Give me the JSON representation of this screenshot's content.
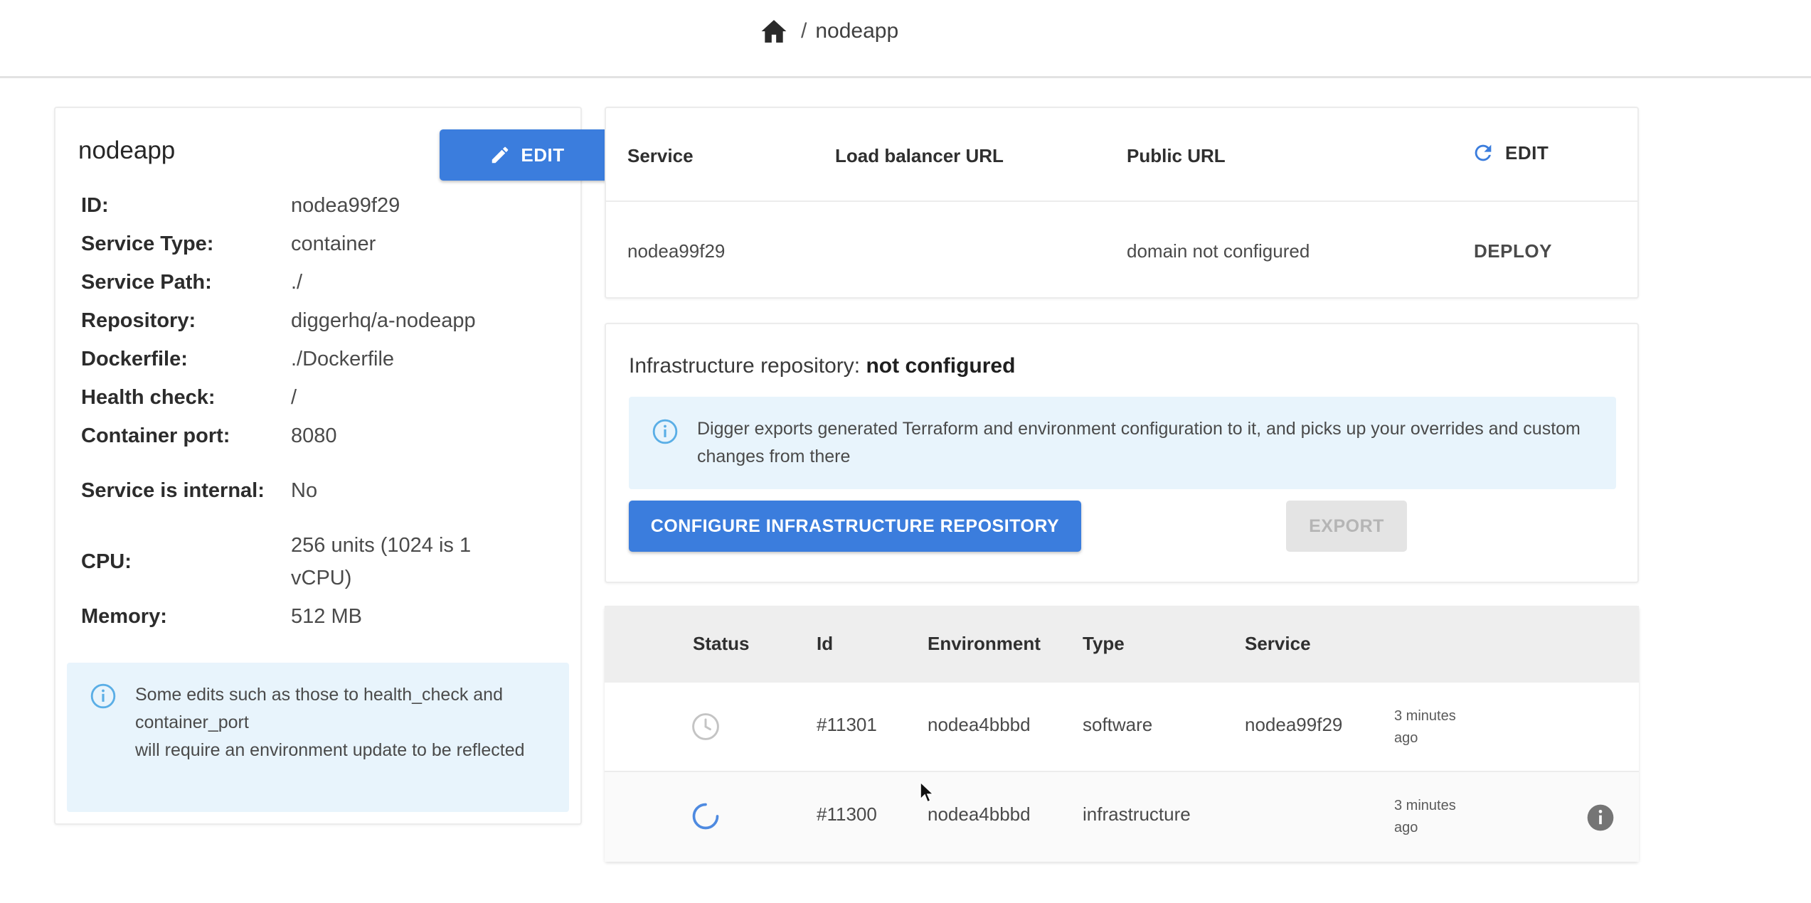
{
  "breadcrumb": {
    "separator": "/",
    "current": "nodeapp"
  },
  "service": {
    "title": "nodeapp",
    "edit_label": "EDIT",
    "details": [
      {
        "label": "ID:",
        "value": "nodea99f29"
      },
      {
        "label": "Service Type:",
        "value": "container"
      },
      {
        "label": "Service Path:",
        "value": "./"
      },
      {
        "label": "Repository:",
        "value": "diggerhq/a-nodeapp"
      },
      {
        "label": "Dockerfile:",
        "value": "./Dockerfile"
      },
      {
        "label": "Health check:",
        "value": "/"
      },
      {
        "label": "Container port:",
        "value": "8080"
      },
      {
        "label": "Service is internal:",
        "value": "No"
      },
      {
        "label": "CPU:",
        "value": "256 units (1024 is 1 vCPU)"
      },
      {
        "label": "Memory:",
        "value": "512 MB"
      }
    ],
    "info_note": "Some edits such as those to health_check and container_port\nwill require an environment update to be reflected"
  },
  "service_table": {
    "headers": {
      "service": "Service",
      "lb_url": "Load balancer URL",
      "public_url": "Public URL",
      "edit": "EDIT"
    },
    "row": {
      "service": "nodea99f29",
      "lb_url": "",
      "public_url": "domain not configured",
      "action": "DEPLOY"
    }
  },
  "infra": {
    "label": "Infrastructure repository:",
    "status": "not configured",
    "info": "Digger exports generated Terraform and environment configuration to it, and picks up your overrides and custom changes from there",
    "configure_label": "CONFIGURE INFRASTRUCTURE REPOSITORY",
    "export_label": "EXPORT"
  },
  "deployments": {
    "headers": {
      "status": "Status",
      "id": "Id",
      "environment": "Environment",
      "type": "Type",
      "service": "Service"
    },
    "rows": [
      {
        "status": "pending",
        "id": "#11301",
        "environment": "nodea4bbbd",
        "type": "software",
        "service": "nodea99f29",
        "time": "3 minutes ago"
      },
      {
        "status": "in-progress",
        "id": "#11300",
        "environment": "nodea4bbbd",
        "type": "infrastructure",
        "service": "",
        "time": "3 minutes ago"
      }
    ]
  },
  "colors": {
    "accent": "#3b7ddd",
    "info_bg": "#e8f4fc",
    "info_icon": "#5aaee6",
    "header_bg": "#eeeeee"
  }
}
